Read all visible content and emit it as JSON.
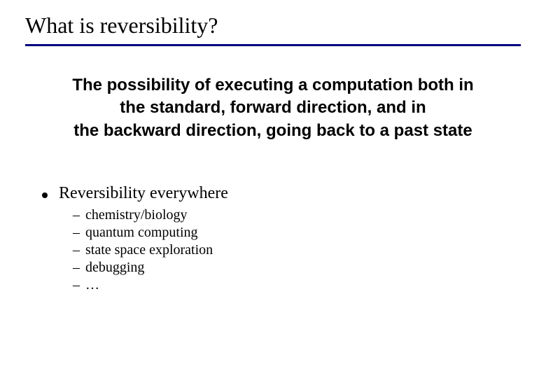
{
  "title": "What is reversibility?",
  "definition_line1": "The possibility of executing a computation both in",
  "definition_line2": "the standard, forward direction, and in",
  "definition_line3": "the backward direction, going back to a past state",
  "bullet1": "Reversibility everywhere",
  "subitems": {
    "0": "chemistry/biology",
    "1": "quantum computing",
    "2": "state space exploration",
    "3": "debugging",
    "4": "…"
  },
  "dash": "–"
}
